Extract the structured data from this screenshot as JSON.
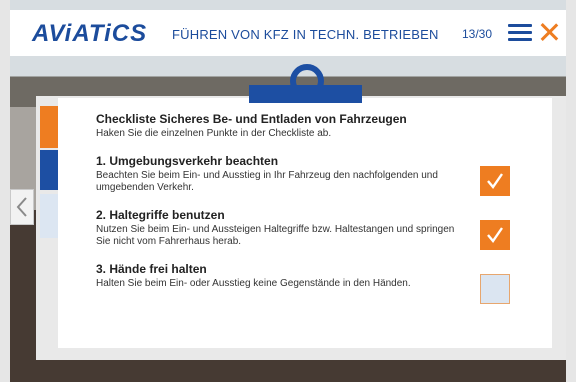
{
  "header": {
    "logo": "AViATiCS",
    "course_title": "FÜHREN VON KFZ IN TECHN. BETRIEBEN",
    "page_counter": "13/30"
  },
  "checklist": {
    "title": "Checkliste Sicheres Be- und Entladen von Fahrzeugen",
    "instruction": "Haken Sie die einzelnen Punkte in der Checkliste ab.",
    "items": [
      {
        "title": "1. Umgebungsverkehr beachten",
        "description": "Beachten Sie beim Ein- und Ausstieg in Ihr Fahrzeug den nachfolgenden und umgebenden Verkehr.",
        "checked": true
      },
      {
        "title": "2. Haltegriffe benutzen",
        "description": "Nutzen Sie beim Ein- und Aussteigen Haltegriffe bzw. Haltestangen und springen Sie nicht vom Fahrerhaus herab.",
        "checked": true
      },
      {
        "title": "3. Hände frei halten",
        "description": "Halten Sie beim Ein- oder Ausstieg keine Gegenstände in den Händen.",
        "checked": false
      }
    ]
  },
  "colors": {
    "brand_blue": "#1c4c9c",
    "accent_orange": "#ee7d21",
    "unchecked_fill": "#dbe5f1"
  },
  "icons": {
    "menu": "hamburger-menu-icon",
    "close": "close-icon",
    "prev": "chevron-left-icon",
    "check": "checkmark-icon"
  }
}
